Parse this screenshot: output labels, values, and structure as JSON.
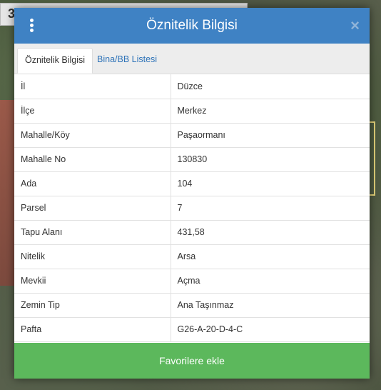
{
  "dialog": {
    "title": "Öznitelik Bilgisi",
    "close_label": "×",
    "tabs": [
      {
        "label": "Öznitelik Bilgisi",
        "active": true
      },
      {
        "label": "Bina/BB Listesi",
        "active": false
      }
    ],
    "rows": [
      {
        "key": "İl",
        "value": "Düzce"
      },
      {
        "key": "İlçe",
        "value": "Merkez"
      },
      {
        "key": "Mahalle/Köy",
        "value": "Paşaormanı"
      },
      {
        "key": "Mahalle No",
        "value": "130830"
      },
      {
        "key": "Ada",
        "value": "104"
      },
      {
        "key": "Parsel",
        "value": "7"
      },
      {
        "key": "Tapu Alanı",
        "value": "431,58"
      },
      {
        "key": "Nitelik",
        "value": "Arsa"
      },
      {
        "key": "Mevkii",
        "value": "Açma"
      },
      {
        "key": "Zemin Tip",
        "value": "Ana Taşınmaz"
      },
      {
        "key": "Pafta",
        "value": "G26-A-20-D-4-C"
      }
    ],
    "favorite_label": "Favorilere ekle"
  },
  "map": {
    "toolbar_glyph": "3"
  },
  "colors": {
    "header": "#3f82c4",
    "favorite": "#5cb85c",
    "tab_link": "#2e73b8"
  }
}
